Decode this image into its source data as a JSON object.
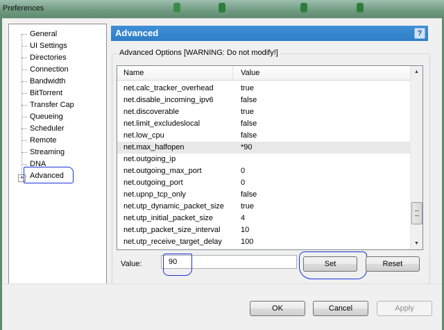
{
  "window": {
    "title": "Preferences"
  },
  "tree": {
    "items": [
      {
        "label": "General"
      },
      {
        "label": "UI Settings"
      },
      {
        "label": "Directories"
      },
      {
        "label": "Connection"
      },
      {
        "label": "Bandwidth"
      },
      {
        "label": "BitTorrent"
      },
      {
        "label": "Transfer Cap"
      },
      {
        "label": "Queueing"
      },
      {
        "label": "Scheduler"
      },
      {
        "label": "Remote"
      },
      {
        "label": "Streaming"
      },
      {
        "label": "DNA"
      },
      {
        "label": "Advanced"
      }
    ],
    "expander_glyph": "+"
  },
  "panel": {
    "title": "Advanced",
    "help_glyph": "?",
    "group_label": "Advanced Options [WARNING: Do not modify!]"
  },
  "list": {
    "columns": [
      "Name",
      "Value"
    ],
    "rows": [
      {
        "name": "net.calc_tracker_overhead",
        "value": "true"
      },
      {
        "name": "net.disable_incoming_ipv6",
        "value": "false"
      },
      {
        "name": "net.discoverable",
        "value": "true"
      },
      {
        "name": "net.limit_excludeslocal",
        "value": "false"
      },
      {
        "name": "net.low_cpu",
        "value": "false"
      },
      {
        "name": "net.max_halfopen",
        "value": "*90"
      },
      {
        "name": "net.outgoing_ip",
        "value": ""
      },
      {
        "name": "net.outgoing_max_port",
        "value": "0"
      },
      {
        "name": "net.outgoing_port",
        "value": "0"
      },
      {
        "name": "net.upnp_tcp_only",
        "value": "false"
      },
      {
        "name": "net.utp_dynamic_packet_size",
        "value": "true"
      },
      {
        "name": "net.utp_initial_packet_size",
        "value": "4"
      },
      {
        "name": "net.utp_packet_size_interval",
        "value": "10"
      },
      {
        "name": "net.utp_receive_target_delay",
        "value": "100"
      }
    ],
    "scroll_up_glyph": "▲",
    "scroll_down_glyph": "▼"
  },
  "editor": {
    "value_label": "Value:",
    "value": "90",
    "set_label": "Set",
    "reset_label": "Reset"
  },
  "footer": {
    "ok_label": "OK",
    "cancel_label": "Cancel",
    "apply_label": "Apply"
  },
  "colors": {
    "banner": "#3389d0",
    "annotation": "#1a2fd8"
  }
}
